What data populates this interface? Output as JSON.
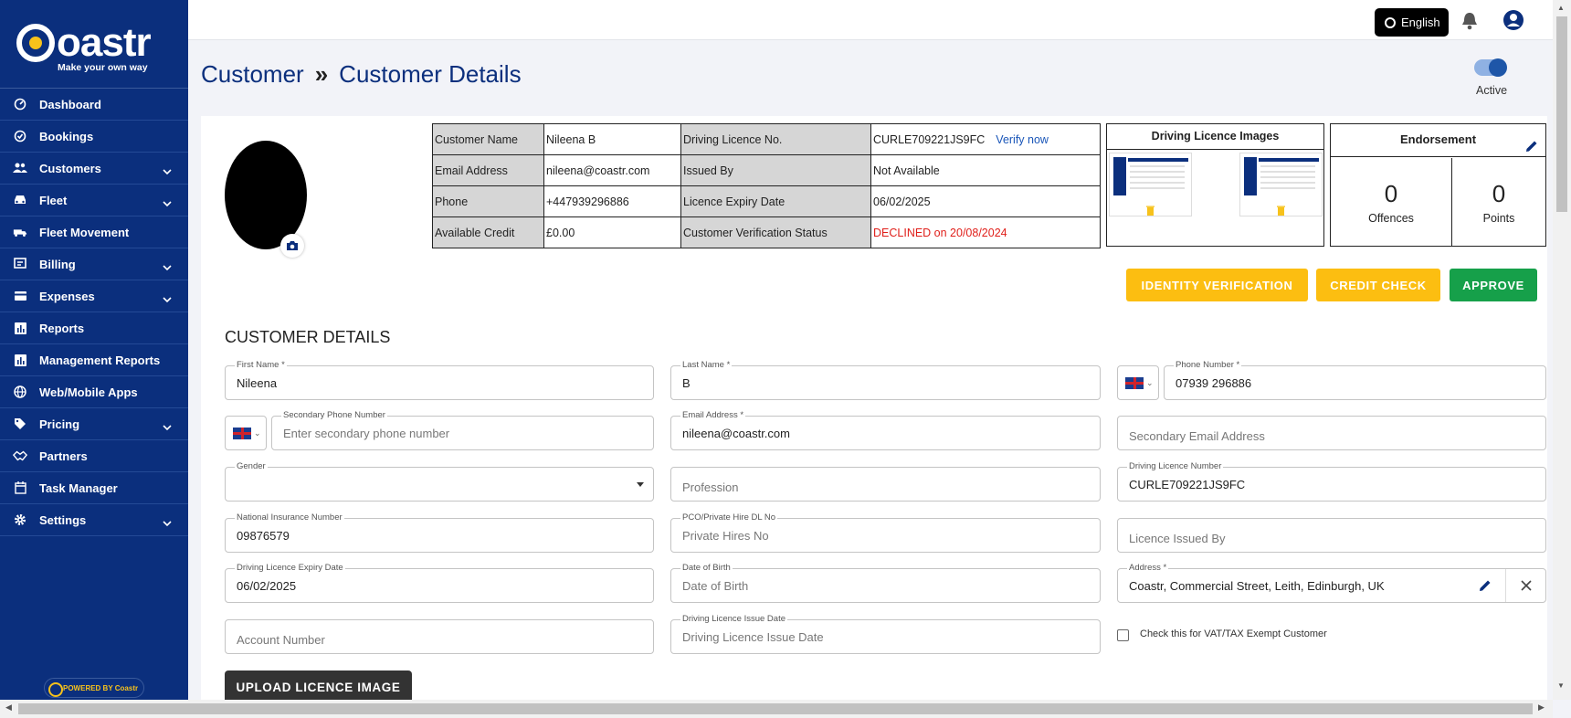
{
  "brand": {
    "name": "Coastr",
    "tagline": "Make your own way",
    "powered_by": "POWERED BY Coastr"
  },
  "sidebar": {
    "items": [
      {
        "label": "Dashboard",
        "icon": "dashboard-icon",
        "expandable": false
      },
      {
        "label": "Bookings",
        "icon": "check-circle-icon",
        "expandable": false
      },
      {
        "label": "Customers",
        "icon": "people-icon",
        "expandable": true
      },
      {
        "label": "Fleet",
        "icon": "car-icon",
        "expandable": true
      },
      {
        "label": "Fleet Movement",
        "icon": "truck-icon",
        "expandable": false
      },
      {
        "label": "Billing",
        "icon": "billing-icon",
        "expandable": true
      },
      {
        "label": "Expenses",
        "icon": "card-icon",
        "expandable": true
      },
      {
        "label": "Reports",
        "icon": "chart-icon",
        "expandable": false
      },
      {
        "label": "Management Reports",
        "icon": "chart-icon",
        "expandable": false
      },
      {
        "label": "Web/Mobile Apps",
        "icon": "globe-icon",
        "expandable": false
      },
      {
        "label": "Pricing",
        "icon": "tag-icon",
        "expandable": true
      },
      {
        "label": "Partners",
        "icon": "handshake-icon",
        "expandable": false
      },
      {
        "label": "Task Manager",
        "icon": "calendar-icon",
        "expandable": false
      },
      {
        "label": "Settings",
        "icon": "gear-icon",
        "expandable": true
      }
    ]
  },
  "topbar": {
    "language": "English"
  },
  "header": {
    "breadcrumb": [
      "Customer",
      "»",
      "Customer Details"
    ],
    "status_label": "Active",
    "status_on": true
  },
  "info_table": {
    "rows": [
      {
        "l1": "Customer Name",
        "v1": "Nileena B",
        "l2": "Driving Licence No.",
        "v2": "CURLE709221JS9FC",
        "link": "Verify now"
      },
      {
        "l1": "Email Address",
        "v1": "nileena@coastr.com",
        "l2": "Issued By",
        "v2": "Not Available"
      },
      {
        "l1": "Phone",
        "v1": "+447939296886",
        "l2": "Licence Expiry Date",
        "v2": "06/02/2025"
      },
      {
        "l1": "Available Credit",
        "v1": "£0.00",
        "l2": "Customer Verification Status",
        "v2": "DECLINED on 20/08/2024"
      }
    ]
  },
  "licence_images": {
    "title": "Driving Licence Images"
  },
  "endorsement": {
    "title": "Endorsement",
    "offences_value": "0",
    "offences_label": "Offences",
    "points_value": "0",
    "points_label": "Points"
  },
  "actions": {
    "identity": "IDENTITY VERIFICATION",
    "credit": "CREDIT CHECK",
    "approve": "APPROVE"
  },
  "colors": {
    "sidebar": "#0b2f7d",
    "accent_yellow": "#fcbe11",
    "approve_green": "#16a04a",
    "declined_red": "#e0201b"
  },
  "form": {
    "title": "CUSTOMER DETAILS",
    "first_name": {
      "label": "First Name *",
      "value": "Nileena"
    },
    "last_name": {
      "label": "Last Name *",
      "value": "B"
    },
    "phone": {
      "label": "Phone Number *",
      "value": "07939 296886"
    },
    "secondary_phone": {
      "label": "Secondary Phone Number",
      "placeholder": "Enter secondary phone number"
    },
    "email": {
      "label": "Email Address *",
      "value": "nileena@coastr.com"
    },
    "secondary_email": {
      "placeholder": "Secondary Email Address"
    },
    "gender": {
      "label": "Gender",
      "value": ""
    },
    "profession": {
      "placeholder": "Profession"
    },
    "dl_number": {
      "label": "Driving Licence Number",
      "value": "CURLE709221JS9FC"
    },
    "ni_number": {
      "label": "National Insurance Number",
      "value": "09876579"
    },
    "pco": {
      "label": "PCO/Private Hire DL No",
      "placeholder": "Private Hires No"
    },
    "licence_issued_by": {
      "placeholder": "Licence Issued By"
    },
    "dl_expiry": {
      "label": "Driving Licence Expiry Date",
      "value": "06/02/2025"
    },
    "dob": {
      "label": "Date of Birth",
      "placeholder": "Date of Birth"
    },
    "address": {
      "label": "Address *",
      "value": "Coastr, Commercial Street, Leith, Edinburgh, UK"
    },
    "account_number": {
      "placeholder": "Account Number"
    },
    "dl_issue_date": {
      "label": "Driving Licence Issue Date",
      "placeholder": "Driving Licence Issue Date"
    },
    "vat_exempt": {
      "label": "Check this for VAT/TAX Exempt Customer",
      "checked": false
    },
    "upload_button": "UPLOAD LICENCE IMAGE"
  }
}
